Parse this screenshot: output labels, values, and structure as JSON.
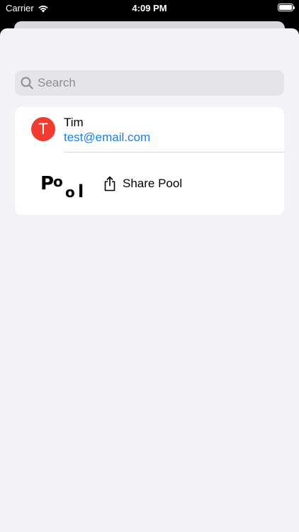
{
  "status_bar": {
    "carrier": "Carrier",
    "time": "4:09 PM"
  },
  "search": {
    "placeholder": "Search",
    "value": ""
  },
  "contact": {
    "initial": "T",
    "name": "Tim",
    "email": "test@email.com",
    "avatar_color": "#f23b30"
  },
  "share": {
    "logo_text": "Pool",
    "label": "Share Pool",
    "icon": "share-icon"
  },
  "colors": {
    "background": "#f2f2f7",
    "link": "#1a7fe0",
    "card": "#ffffff"
  }
}
